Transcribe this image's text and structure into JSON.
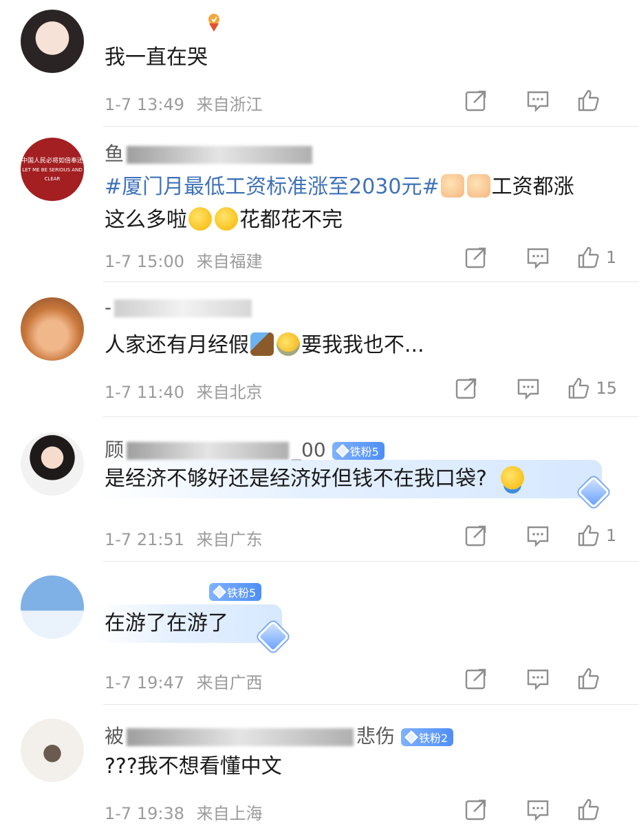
{
  "comments": [
    {
      "username": "",
      "badge": "",
      "text_parts": [
        "我一直在哭"
      ],
      "time": "1-7 13:49",
      "location": "来自浙江",
      "likes": ""
    },
    {
      "username": "鱼",
      "badge": "",
      "topic": "#厦门月最低工资标准涨至2030元#",
      "text_line1_tail": "工资都涨",
      "text_line2_a": "这么多啦",
      "text_line2_b": "花都花不完",
      "avatar_lines": [
        "中国人民必将如倍奉还",
        "LET ME BE SERIOUS AND CLEAR"
      ],
      "time": "1-7 15:00",
      "location": "来自福建",
      "likes": "1"
    },
    {
      "username": "-",
      "badge": "",
      "text_a": "人家还有月经假",
      "text_b": "要我我也不...",
      "time": "1-7 11:40",
      "location": "来自北京",
      "likes": "15"
    },
    {
      "username_prefix": "顾",
      "username_suffix": "_00",
      "badge": "铁粉5",
      "text": "是经济不够好还是经济好但钱不在我口袋?",
      "time": "1-7 21:51",
      "location": "来自广东",
      "likes": "1"
    },
    {
      "username": "",
      "badge": "铁粉5",
      "text": "在游了在游了",
      "time": "1-7 19:47",
      "location": "来自广西",
      "likes": ""
    },
    {
      "username_prefix": "被",
      "username_suffix": "悲伤",
      "badge": "铁粉2",
      "text": "???我不想看懂中文",
      "time": "1-7 19:38",
      "location": "来自上海",
      "likes": ""
    }
  ],
  "icons": {
    "repost": "repost-icon",
    "reply": "comment-icon",
    "like": "thumbs-up-icon",
    "badge_gem": "diamond-icon",
    "medal": "medal-icon"
  },
  "colors": {
    "topic": "#3f72b8",
    "meta": "#9b9b9b",
    "badge": "#4f8ef5"
  }
}
